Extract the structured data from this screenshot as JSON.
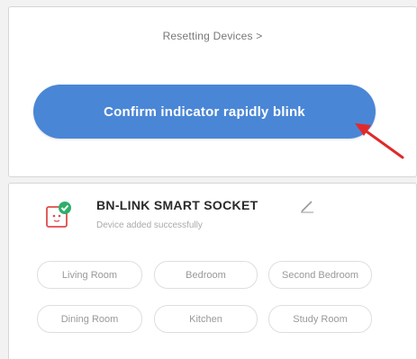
{
  "reset": {
    "label": "Resetting Devices >"
  },
  "confirm_button": {
    "label": "Confirm indicator rapidly blink"
  },
  "device": {
    "name": "BN-LINK SMART SOCKET",
    "status": "Device added successfully"
  },
  "rooms": [
    "Living Room",
    "Bedroom",
    "Second Bedroom",
    "Dining Room",
    "Kitchen",
    "Study Room"
  ],
  "colors": {
    "accent": "#4a86d6",
    "annotation_arrow": "#e02a2a",
    "success_badge": "#2fae6b",
    "device_icon": "#e04b4b"
  }
}
